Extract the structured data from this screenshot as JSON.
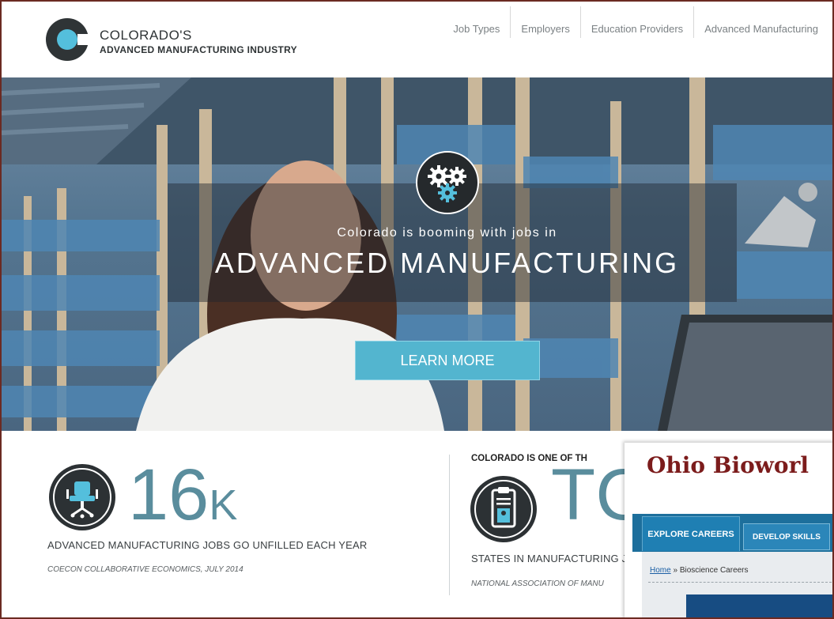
{
  "logo": {
    "line1": "COLORADO'S",
    "line2": "ADVANCED MANUFACTURING INDUSTRY"
  },
  "nav": [
    "Job Types",
    "Employers",
    "Education Providers",
    "Advanced Manufacturing"
  ],
  "hero": {
    "subtitle": "Colorado is booming with jobs in",
    "title": "ADVANCED MANUFACTURING",
    "button": "LEARN MORE"
  },
  "stat1": {
    "number": "16",
    "unit": "K",
    "caption": "ADVANCED MANUFACTURING JOBS GO UNFILLED EACH YEAR",
    "source": "COECON COLLABORATIVE ECONOMICS, JULY 2014"
  },
  "stat2": {
    "heading": "COLORADO IS ONE OF TH",
    "number": "TC",
    "caption": "STATES IN MANUFACTURING J",
    "source": "NATIONAL ASSOCIATION OF MANU"
  },
  "overlay": {
    "title": "Ohio Bioworl",
    "tab_active": "EXPLORE CAREERS",
    "tab_2": "DEVELOP SKILLS",
    "crumb_home": "Home",
    "crumb_sep": " » ",
    "crumb_current": "Bioscience Careers"
  },
  "colors": {
    "accent": "#53b5cf",
    "stat": "#5a8d9d",
    "brand_dark": "#2f3436",
    "overlay_title": "#7c1c1c",
    "border": "#6b2a22"
  }
}
